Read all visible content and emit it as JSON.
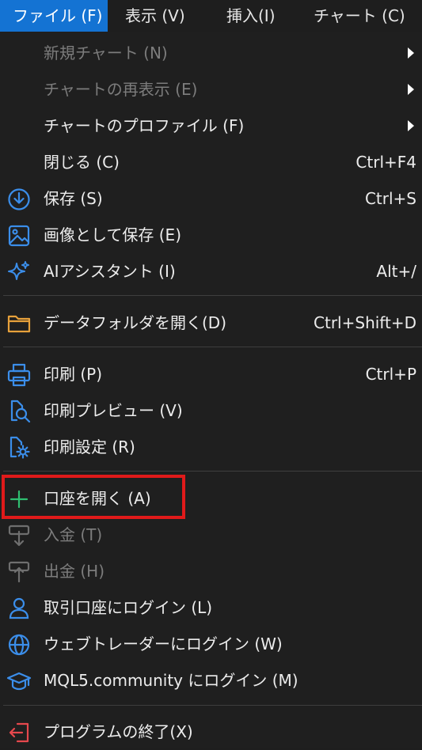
{
  "menubar": {
    "items": [
      {
        "label": "ファイル (F)"
      },
      {
        "label": "表示 (V)"
      },
      {
        "label": "挿入(I)"
      },
      {
        "label": "チャート (C)"
      }
    ]
  },
  "menu": {
    "items": [
      {
        "label": "新規チャート (N)",
        "shortcut": "",
        "icon": "",
        "disabled": true,
        "submenu": true
      },
      {
        "label": "チャートの再表示 (E)",
        "shortcut": "",
        "icon": "",
        "disabled": true,
        "submenu": true
      },
      {
        "label": "チャートのプロファイル (F)",
        "shortcut": "",
        "icon": "",
        "disabled": false,
        "submenu": true
      },
      {
        "label": "閉じる (C)",
        "shortcut": "Ctrl+F4",
        "icon": "",
        "disabled": false
      },
      {
        "label": "保存 (S)",
        "shortcut": "Ctrl+S",
        "icon": "save-icon",
        "disabled": false
      },
      {
        "label": "画像として保存 (E)",
        "shortcut": "",
        "icon": "image-icon",
        "disabled": false
      },
      {
        "label": "AIアシスタント (I)",
        "shortcut": "Alt+/",
        "icon": "sparkle-icon",
        "disabled": false
      },
      {
        "label": "データフォルダを開く(D)",
        "shortcut": "Ctrl+Shift+D",
        "icon": "folder-icon",
        "disabled": false
      },
      {
        "label": "印刷 (P)",
        "shortcut": "Ctrl+P",
        "icon": "printer-icon",
        "disabled": false
      },
      {
        "label": "印刷プレビュー (V)",
        "shortcut": "",
        "icon": "print-preview-icon",
        "disabled": false
      },
      {
        "label": "印刷設定 (R)",
        "shortcut": "",
        "icon": "print-settings-icon",
        "disabled": false
      },
      {
        "label": "口座を開く (A)",
        "shortcut": "",
        "icon": "plus-icon",
        "disabled": false
      },
      {
        "label": "入金 (T)",
        "shortcut": "",
        "icon": "deposit-icon",
        "disabled": true
      },
      {
        "label": "出金 (H)",
        "shortcut": "",
        "icon": "withdraw-icon",
        "disabled": true
      },
      {
        "label": "取引口座にログイン (L)",
        "shortcut": "",
        "icon": "user-icon",
        "disabled": false
      },
      {
        "label": "ウェブトレーダーにログイン (W)",
        "shortcut": "",
        "icon": "globe-icon",
        "disabled": false
      },
      {
        "label": "MQL5.community にログイン (M)",
        "shortcut": "",
        "icon": "graduation-cap-icon",
        "disabled": false
      },
      {
        "label": "プログラムの終了(X)",
        "shortcut": "",
        "icon": "exit-icon",
        "disabled": false
      }
    ]
  },
  "colors": {
    "accent": "#1473d3",
    "highlight": "#e01a1a",
    "icon_blue": "#3b8eea",
    "icon_green": "#2fbf71",
    "icon_orange": "#e7a13b",
    "icon_red": "#e5484d"
  }
}
